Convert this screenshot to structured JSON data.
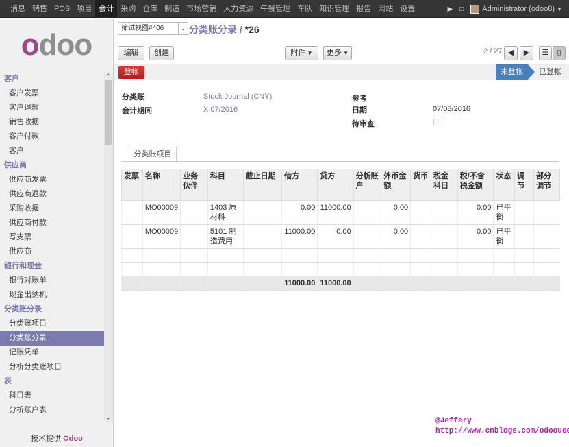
{
  "topbar": {
    "menus": [
      {
        "label": "消息",
        "active": false
      },
      {
        "label": "销售",
        "active": false
      },
      {
        "label": "POS",
        "active": false
      },
      {
        "label": "项目",
        "active": false
      },
      {
        "label": "会计",
        "active": true
      },
      {
        "label": "采购",
        "active": false
      },
      {
        "label": "仓库",
        "active": false
      },
      {
        "label": "制造",
        "active": false
      },
      {
        "label": "市场营销",
        "active": false
      },
      {
        "label": "人力资源",
        "active": false
      },
      {
        "label": "午餐管理",
        "active": false
      },
      {
        "label": "车队",
        "active": false
      },
      {
        "label": "知识管理",
        "active": false
      },
      {
        "label": "报告",
        "active": false
      },
      {
        "label": "网站",
        "active": false
      },
      {
        "label": "设置",
        "active": false
      }
    ],
    "user": "Administrator (odoo8)"
  },
  "sidebar": {
    "logo": "odoo",
    "sections": [
      {
        "title": "客户",
        "items": [
          {
            "label": "客户发票"
          },
          {
            "label": "客户退款"
          },
          {
            "label": "销售收据"
          },
          {
            "label": "客户付款"
          },
          {
            "label": "客户"
          }
        ]
      },
      {
        "title": "供应商",
        "items": [
          {
            "label": "供应商发票"
          },
          {
            "label": "供应商退款"
          },
          {
            "label": "采购收据"
          },
          {
            "label": "供应商付款"
          },
          {
            "label": "写支票"
          },
          {
            "label": "供应商"
          }
        ]
      },
      {
        "title": "银行和现金",
        "items": [
          {
            "label": "银行对账单"
          },
          {
            "label": "现金出纳机"
          }
        ]
      },
      {
        "title": "分类账分录",
        "items": [
          {
            "label": "分类账项目"
          },
          {
            "label": "分类账分录",
            "selected": true
          },
          {
            "label": "记账凭单"
          },
          {
            "label": "分析分类账项目"
          }
        ]
      },
      {
        "title": "表",
        "items": [
          {
            "label": "科目表"
          },
          {
            "label": "分析账户表"
          }
        ]
      }
    ],
    "powered_by": "技术提供",
    "powered_brand": "Odoo"
  },
  "header": {
    "view_select": "筛试视图#406",
    "breadcrumb": "分类账分录",
    "record": "*26",
    "edit_label": "编辑",
    "create_label": "创建",
    "attachment_label": "附件",
    "more_label": "更多",
    "pager": "2 / 27"
  },
  "status": {
    "post_label": "登帐",
    "stages": [
      "未登帐",
      "已登帐"
    ],
    "active_stage": "未登帐"
  },
  "form": {
    "journal_label": "分类账",
    "journal_value": "Stock Journal (CNY)",
    "period_label": "会计期间",
    "period_value": "X 07/2016",
    "ref_label": "参考",
    "ref_value": "",
    "date_label": "日期",
    "date_value": "07/08/2016",
    "review_label": "待审查",
    "review_checked": false
  },
  "tab": {
    "label": "分类账项目"
  },
  "lines": {
    "columns": [
      "发票",
      "名称",
      "业务伙伴",
      "科目",
      "截止日期",
      "借方",
      "贷方",
      "分析账户",
      "外币金额",
      "货币",
      "税金科目",
      "税/不含税金额",
      "状态",
      "调节",
      "部分调节"
    ],
    "rows": [
      {
        "invoice": "",
        "name": "MO00009",
        "partner": "",
        "account": "1403 原材料",
        "due": "",
        "debit": "0.00",
        "credit": "11000.00",
        "analytic": "",
        "amount_currency": "0.00",
        "currency": "",
        "tax_code": "",
        "tax_amount": "0.00",
        "state": "已平衡",
        "rec": "",
        "partial_rec": ""
      },
      {
        "invoice": "",
        "name": "MO00009",
        "partner": "",
        "account": "5101 制造费用",
        "due": "",
        "debit": "11000.00",
        "credit": "0.00",
        "analytic": "",
        "amount_currency": "0.00",
        "currency": "",
        "tax_code": "",
        "tax_amount": "0.00",
        "state": "已平衡",
        "rec": "",
        "partial_rec": ""
      }
    ],
    "total_debit": "11000.00",
    "total_credit": "11000.00"
  },
  "watermark": {
    "line1": "@Jeffery",
    "line2": "http://www.cnblogs.com/odoouse"
  }
}
